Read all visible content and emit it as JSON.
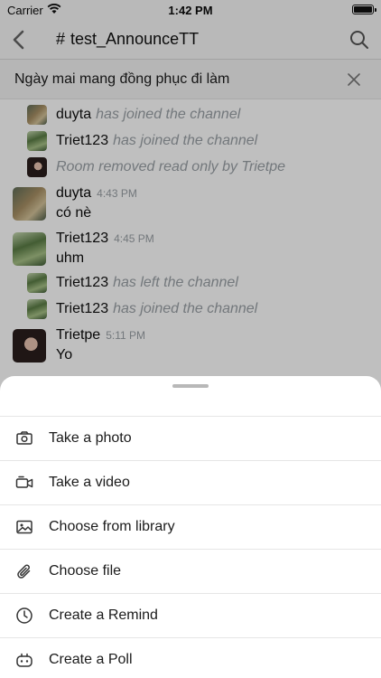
{
  "status_bar": {
    "carrier": "Carrier",
    "time": "1:42 PM"
  },
  "header": {
    "hash": "#",
    "channel_name": "test_AnnounceTT"
  },
  "announcement": {
    "text": "Ngày mai mang đồng phục đi làm"
  },
  "messages": {
    "sys1": {
      "user": "duyta",
      "text": "has joined the channel"
    },
    "sys2": {
      "user": "Triet123",
      "text": "has joined the channel"
    },
    "sys3": {
      "text": "Room removed read only by Trietpe"
    },
    "msg1": {
      "user": "duyta",
      "time": "4:43 PM",
      "text": "có nè"
    },
    "msg2": {
      "user": "Triet123",
      "time": "4:45 PM",
      "text": "uhm"
    },
    "sys4": {
      "user": "Triet123",
      "text": "has left the channel"
    },
    "sys5": {
      "user": "Triet123",
      "text": "has joined the channel"
    },
    "msg3": {
      "user": "Trietpe",
      "time": "5:11 PM",
      "text": "Yo"
    }
  },
  "sheet": {
    "items": [
      {
        "label": "Take a photo",
        "icon": "camera-icon"
      },
      {
        "label": "Take a video",
        "icon": "video-camera-icon"
      },
      {
        "label": "Choose from library",
        "icon": "image-icon"
      },
      {
        "label": "Choose file",
        "icon": "paperclip-icon"
      },
      {
        "label": "Create a Remind",
        "icon": "clock-icon"
      },
      {
        "label": "Create a Poll",
        "icon": "poll-icon"
      }
    ]
  }
}
